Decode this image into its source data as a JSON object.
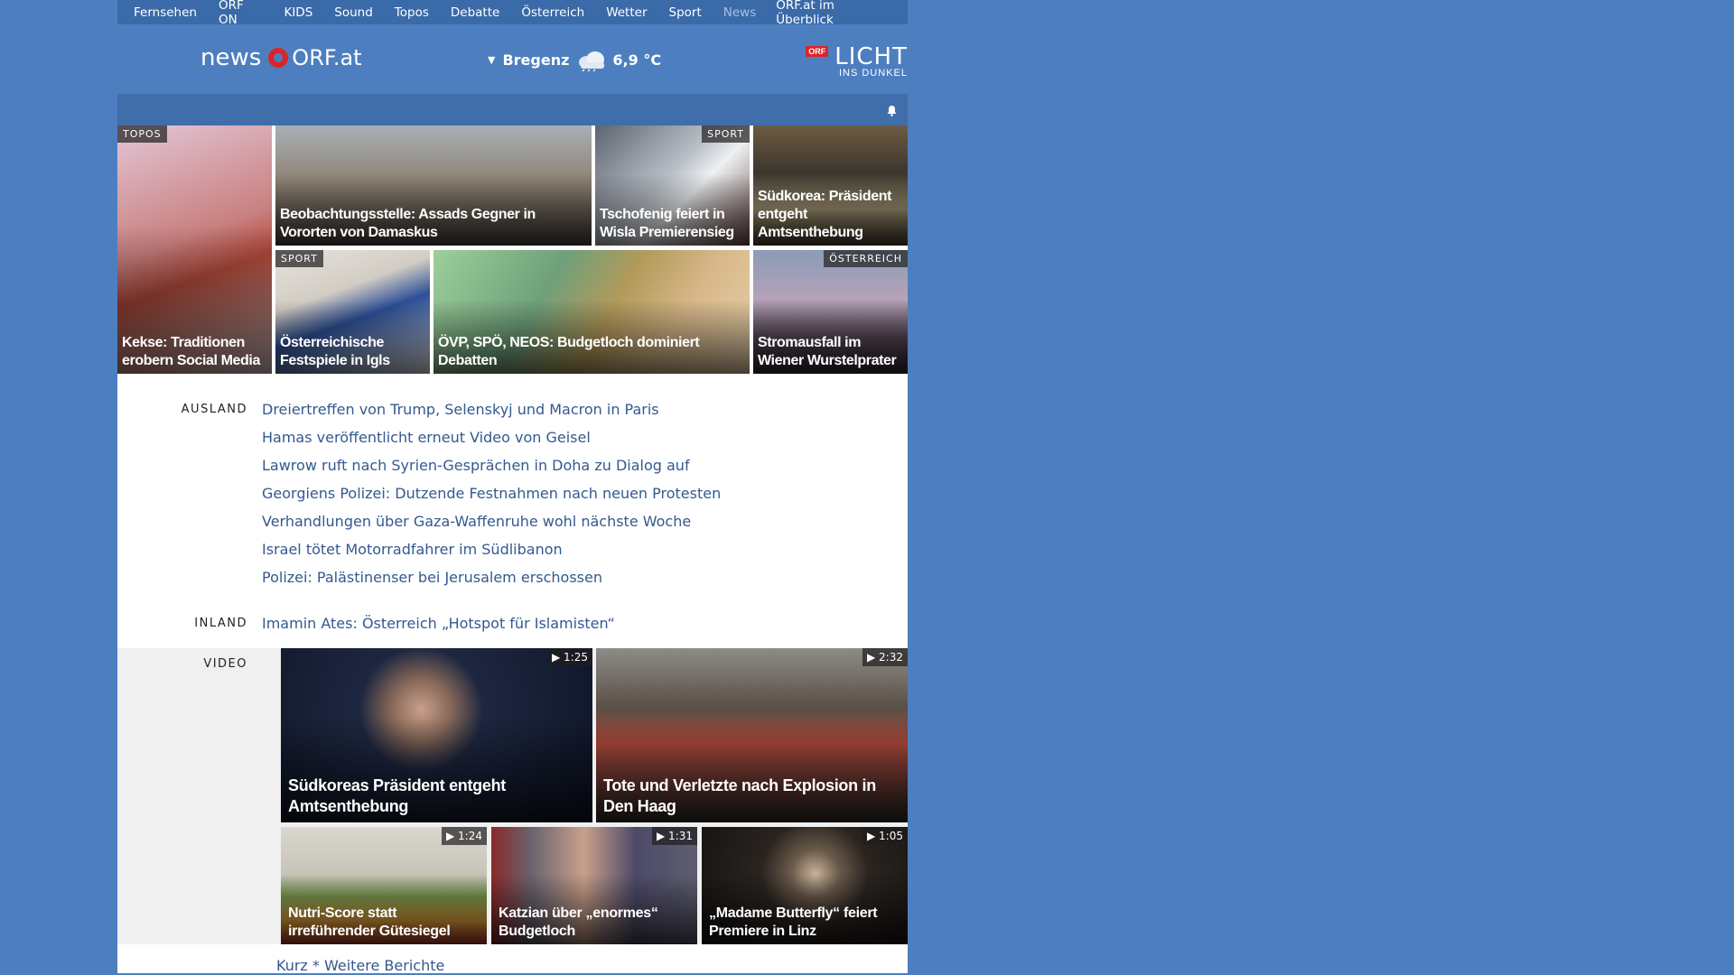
{
  "topnav": {
    "items": [
      "Fernsehen",
      "ORF ON",
      "KIDS",
      "Sound",
      "Topos",
      "Debatte",
      "Österreich",
      "Wetter",
      "Sport",
      "News"
    ],
    "overview": "ORF.at im Überblick"
  },
  "header": {
    "logo_news": "news",
    "logo_orf": "ORF.at",
    "weather": {
      "location": "Bregenz",
      "temperature": "6,9 °C",
      "icon": "cloud-icon"
    },
    "licht": {
      "badge": "ORF",
      "title": "LICHT",
      "subtitle": "INS DUNKEL"
    }
  },
  "tiles": [
    {
      "tag": "TOPOS",
      "caption": "Kekse: Traditionen erobern Social Media",
      "color": "#b05a5a"
    },
    {
      "tag": "",
      "caption": "Beobachtungsstelle: Assads Gegner in Vororten von Damaskus",
      "color": "#8a8272"
    },
    {
      "tag": "SPORT",
      "caption": "Tschofenig feiert in Wisla Premierensieg",
      "color": "#6f7b88"
    },
    {
      "tag": "",
      "caption": "Südkorea: Präsident entgeht Amtsenthebung",
      "color": "#6b5a40"
    },
    {
      "tag": "SPORT",
      "caption": "Österreichische Festspiele in Igls",
      "color": "#7d8fae"
    },
    {
      "tag": "",
      "caption": "ÖVP, SPÖ, NEOS: Budgetloch dominiert Debatten",
      "color": "#7e9a6e"
    },
    {
      "tag": "ÖSTERREICH",
      "caption": "Stromausfall im Wiener Wurstelprater",
      "color": "#6a6f8a"
    }
  ],
  "sections": {
    "ausland": {
      "label": "AUSLAND",
      "links": [
        "Dreiertreffen von Trump, Selenskyj und Macron in Paris",
        "Hamas veröffentlicht erneut Video von Geisel",
        "Lawrow ruft nach Syrien-Gesprächen in Doha zu Dialog auf",
        "Georgiens Polizei: Dutzende Festnahmen nach neuen Protesten",
        "Verhandlungen über Gaza-Waffenruhe wohl nächste Woche",
        "Israel tötet Motorradfahrer im Südlibanon",
        "Polizei: Palästinenser bei Jerusalem erschossen"
      ]
    },
    "inland": {
      "label": "INLAND",
      "links": [
        "Imamin Ates: Österreich „Hotspot für Islamisten“"
      ]
    }
  },
  "video": {
    "label": "VIDEO",
    "items": [
      {
        "duration": "1:25",
        "caption": "Südkoreas Präsident entgeht Amtsenthebung",
        "color": "#1f2a44"
      },
      {
        "duration": "2:32",
        "caption": "Tote und Verletzte nach Explosion in Den Haag",
        "color": "#5a4a40"
      },
      {
        "duration": "1:24",
        "caption": "Nutri-Score statt irreführender Gütesiegel",
        "color": "#c9c4b5"
      },
      {
        "duration": "1:31",
        "caption": "Katzian über „enormes“ Budgetloch",
        "color": "#4a4650"
      },
      {
        "duration": "1:05",
        "caption": "„Madame Butterfly“ feiert Premiere in Linz",
        "color": "#2a2420"
      }
    ]
  },
  "more_link": "Kurz * Weitere Berichte"
}
